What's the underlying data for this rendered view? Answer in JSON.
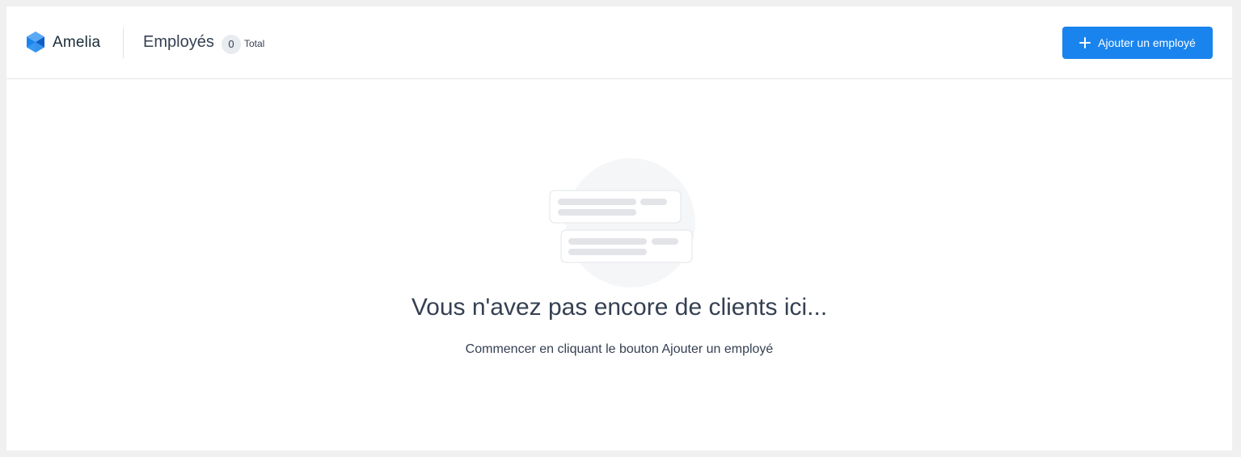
{
  "app": {
    "name": "Amelia",
    "logo_colors": [
      "#1a84ee",
      "#5aa9f5",
      "#0f5ec7"
    ]
  },
  "header": {
    "title": "Employés",
    "count": "0",
    "count_label": "Total",
    "add_button_label": "Ajouter un employé",
    "add_button_icon": "plus-icon"
  },
  "empty_state": {
    "title": "Vous n'avez pas encore de clients ici...",
    "subtitle": "Commencer en cliquant le bouton Ajouter un employé",
    "illustration": "empty-list-illustration"
  },
  "colors": {
    "accent": "#1a84ee",
    "text": "#354052",
    "background": "#f0f0f1"
  }
}
